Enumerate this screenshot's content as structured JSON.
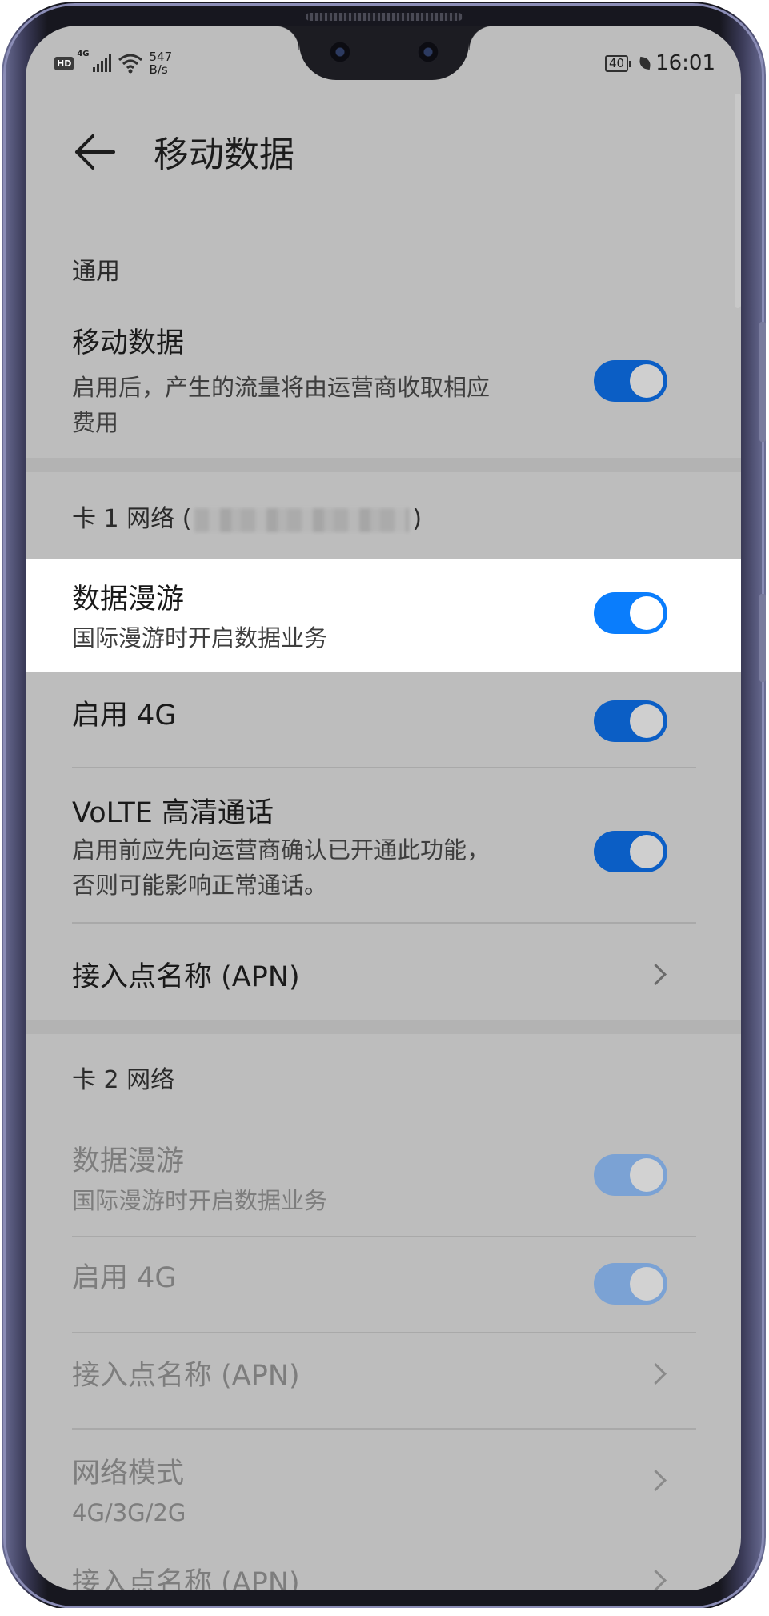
{
  "status_bar": {
    "hd": "HD",
    "net_type": "4G",
    "speed_value": "547",
    "speed_unit": "B/s",
    "battery": "40",
    "time": "16:01"
  },
  "header": {
    "title": "移动数据"
  },
  "general": {
    "section_label": "通用",
    "mobile_data": {
      "title": "移动数据",
      "subtitle_line1": "启用后，产生的流量将由运营商收取相应",
      "subtitle_line2": "费用",
      "enabled": true
    }
  },
  "sim1": {
    "section_prefix": "卡 1 网络 (",
    "section_suffix": ")",
    "data_roaming": {
      "title": "数据漫游",
      "subtitle": "国际漫游时开启数据业务",
      "enabled": true
    },
    "enable_4g": {
      "title": "启用 4G",
      "enabled": true
    },
    "volte": {
      "title": "VoLTE 高清通话",
      "subtitle_line1": "启用前应先向运营商确认已开通此功能，",
      "subtitle_line2": "否则可能影响正常通话。",
      "enabled": true
    },
    "apn": {
      "title": "接入点名称 (APN)"
    }
  },
  "sim2": {
    "section_label": "卡 2 网络",
    "data_roaming": {
      "title": "数据漫游",
      "subtitle": "国际漫游时开启数据业务",
      "enabled": true
    },
    "enable_4g": {
      "title": "启用 4G",
      "enabled": true
    },
    "apn": {
      "title": "接入点名称 (APN)"
    },
    "network_mode": {
      "title": "网络模式",
      "value": "4G/3G/2G"
    },
    "apn_2": {
      "title": "接入点名称 (APN)"
    }
  },
  "colors": {
    "overlay_gray": "#bdbdbd",
    "toggle_on": "#0b5ec5",
    "toggle_highlight": "#0a7dfc",
    "highlight_row": "#ffffff"
  }
}
